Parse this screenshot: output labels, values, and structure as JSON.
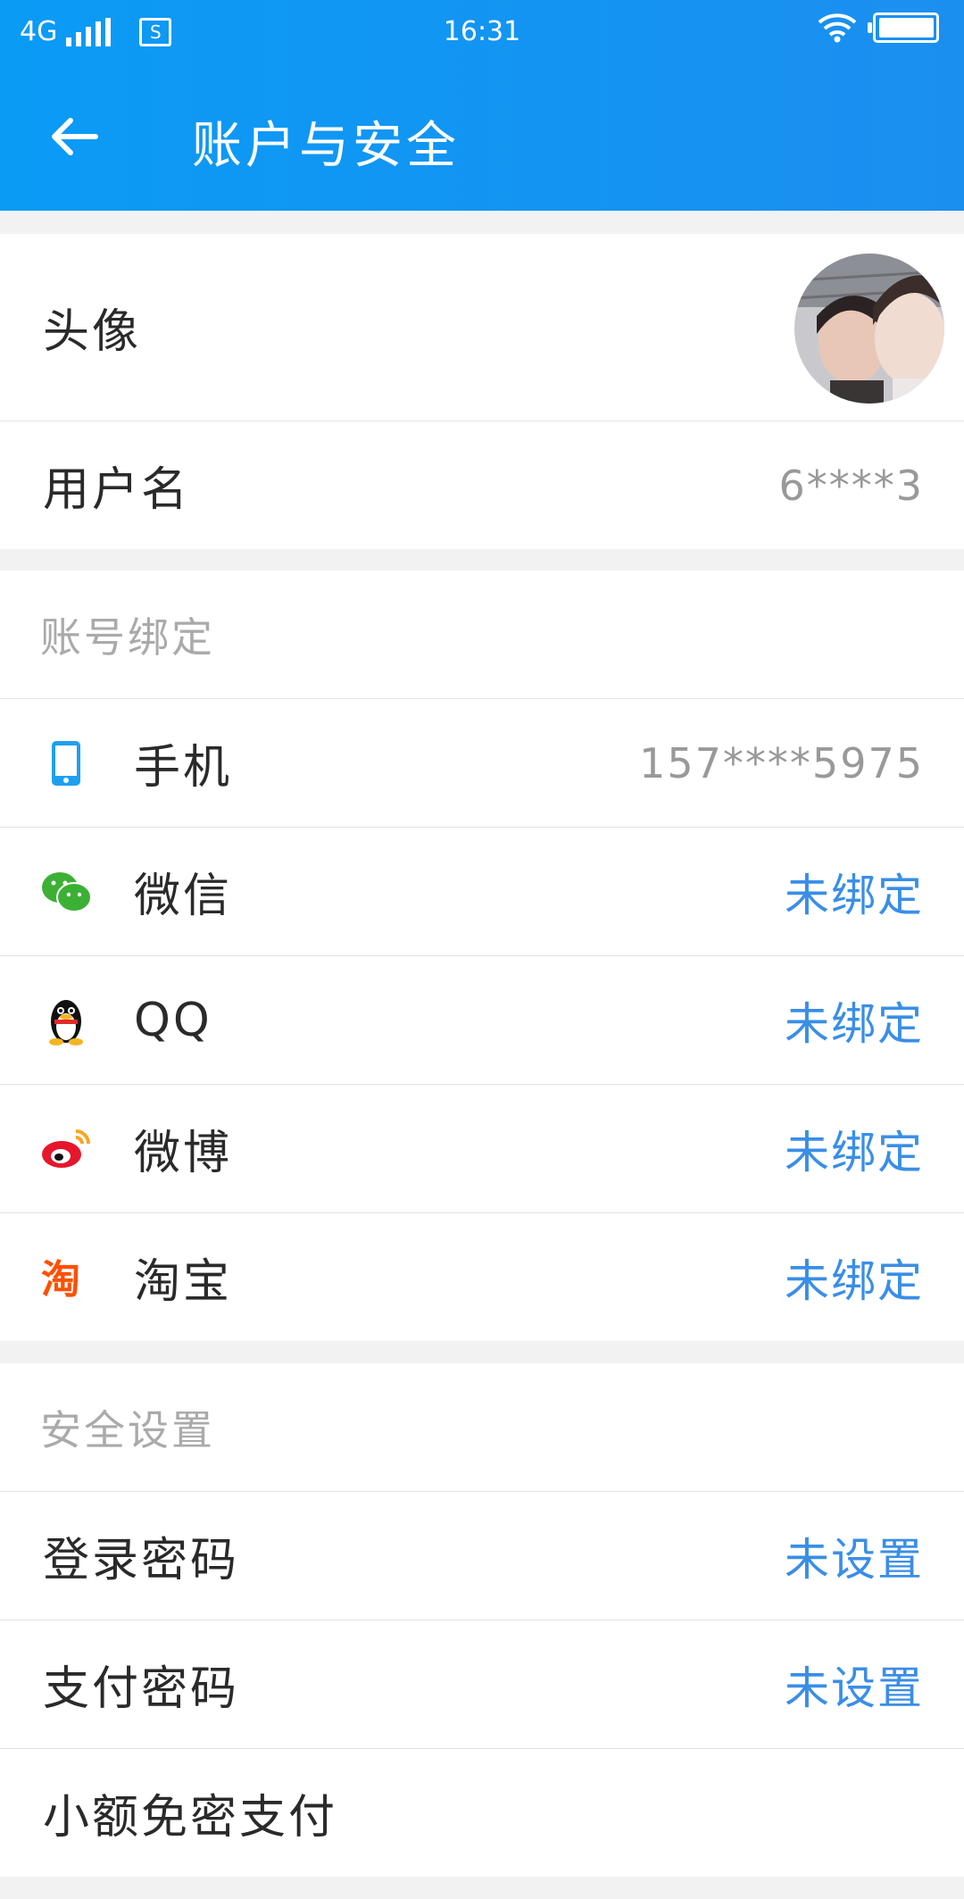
{
  "status_bar": {
    "network": "4G",
    "time": "16:31"
  },
  "app_bar": {
    "title": "账户与安全"
  },
  "profile": {
    "avatar_label": "头像",
    "username_label": "用户名",
    "username_value": "6****3"
  },
  "binding": {
    "header": "账号绑定",
    "items": [
      {
        "icon": "phone-icon",
        "label": "手机",
        "value": "157****5975",
        "color": "#999999"
      },
      {
        "icon": "wechat-icon",
        "label": "微信",
        "value": "未绑定",
        "color": "#3a8ee6"
      },
      {
        "icon": "qq-icon",
        "label": "QQ",
        "value": "未绑定",
        "color": "#3a8ee6"
      },
      {
        "icon": "weibo-icon",
        "label": "微博",
        "value": "未绑定",
        "color": "#3a8ee6"
      },
      {
        "icon": "taobao-icon",
        "label": "淘宝",
        "value": "未绑定",
        "color": "#3a8ee6"
      }
    ]
  },
  "security": {
    "header": "安全设置",
    "items": [
      {
        "label": "登录密码",
        "value": "未设置"
      },
      {
        "label": "支付密码",
        "value": "未设置"
      },
      {
        "label": "小额免密支付",
        "value": ""
      }
    ]
  },
  "colors": {
    "app_bar": "#0a9bf5",
    "accent_blue": "#3a8ee6",
    "background": "#f2f2f2"
  }
}
